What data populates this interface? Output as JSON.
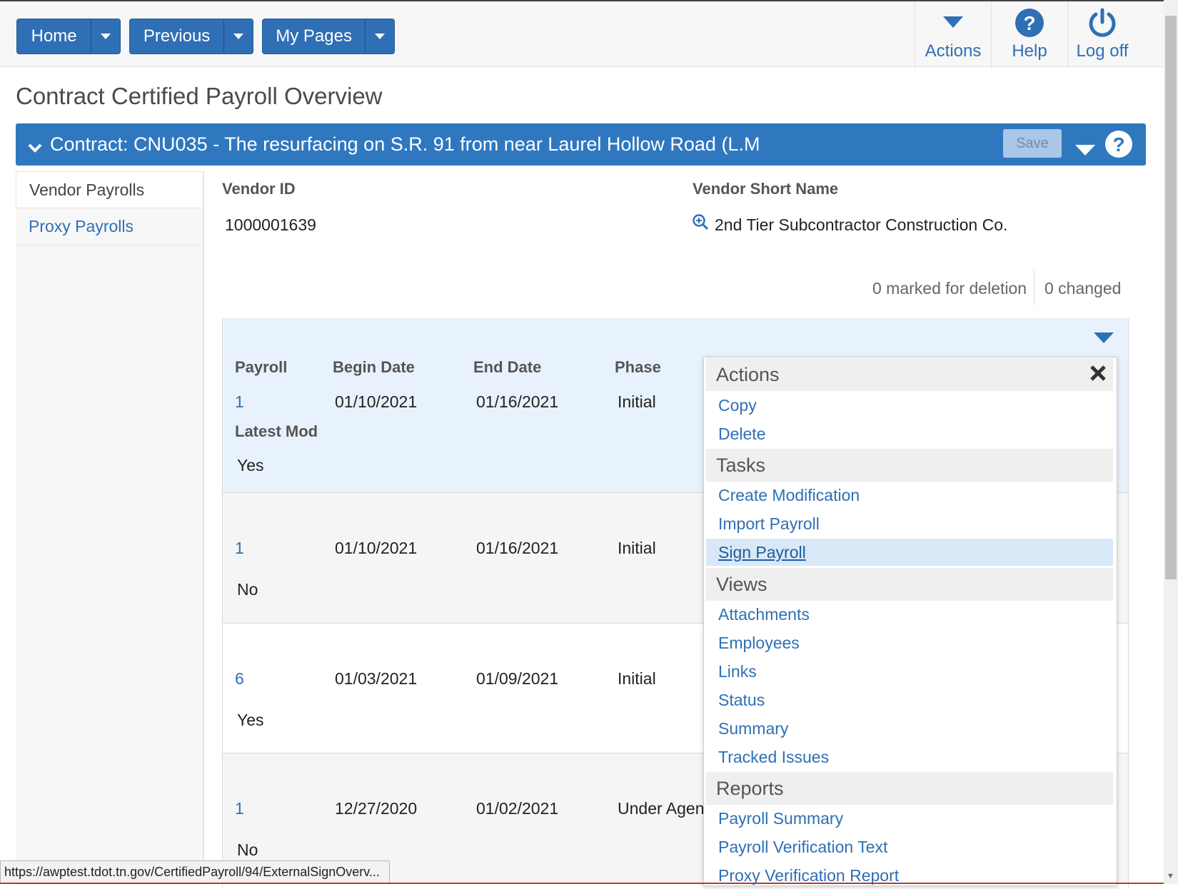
{
  "nav": {
    "home": "Home",
    "previous": "Previous",
    "my_pages": "My Pages"
  },
  "toolbar": {
    "actions": "Actions",
    "help": "Help",
    "logoff": "Log off"
  },
  "page": {
    "title": "Contract Certified Payroll Overview"
  },
  "contract": {
    "title": "Contract: CNU035 - The resurfacing on S.R. 91 from near Laurel Hollow Road (L.M",
    "save": "Save"
  },
  "sidebar": {
    "items": [
      {
        "label": "Vendor Payrolls"
      },
      {
        "label": "Proxy Payrolls"
      }
    ]
  },
  "vendor": {
    "id_label": "Vendor ID",
    "id_value": "1000001639",
    "short_name_label": "Vendor Short Name",
    "short_name_value": "2nd Tier Subcontractor Construction Co."
  },
  "counts": {
    "deletion": "0 marked for deletion",
    "changed": "0 changed"
  },
  "grid": {
    "headers": {
      "payroll": "Payroll",
      "begin": "Begin Date",
      "end": "End Date",
      "phase": "Phase",
      "latest_mod": "Latest Mod"
    },
    "rows": [
      {
        "payroll": "1",
        "begin": "01/10/2021",
        "end": "01/16/2021",
        "phase": "Initial",
        "latest": "Yes"
      },
      {
        "payroll": "1",
        "begin": "01/10/2021",
        "end": "01/16/2021",
        "phase": "Initial",
        "latest": "No"
      },
      {
        "payroll": "6",
        "begin": "01/03/2021",
        "end": "01/09/2021",
        "phase": "Initial",
        "latest": "Yes"
      },
      {
        "payroll": "1",
        "begin": "12/27/2020",
        "end": "01/02/2021",
        "phase": "Under Agen",
        "latest": "No"
      }
    ]
  },
  "menu": {
    "sections": {
      "actions": "Actions",
      "tasks": "Tasks",
      "views": "Views",
      "reports": "Reports"
    },
    "actions": [
      "Copy",
      "Delete"
    ],
    "tasks": [
      "Create Modification",
      "Import Payroll",
      "Sign Payroll"
    ],
    "views": [
      "Attachments",
      "Employees",
      "Links",
      "Status",
      "Summary",
      "Tracked Issues"
    ],
    "reports": [
      "Payroll Summary",
      "Payroll Verification Text",
      "Proxy Verification Report"
    ]
  },
  "status_url": "https://awptest.tdot.tn.gov/CertifiedPayroll/94/ExternalSignOverv...",
  "colors": {
    "primary": "#2f6fb5",
    "contract_bar": "#2f78bf",
    "row_selected": "#e8f2fc",
    "menu_highlight": "#d9e8f7"
  }
}
